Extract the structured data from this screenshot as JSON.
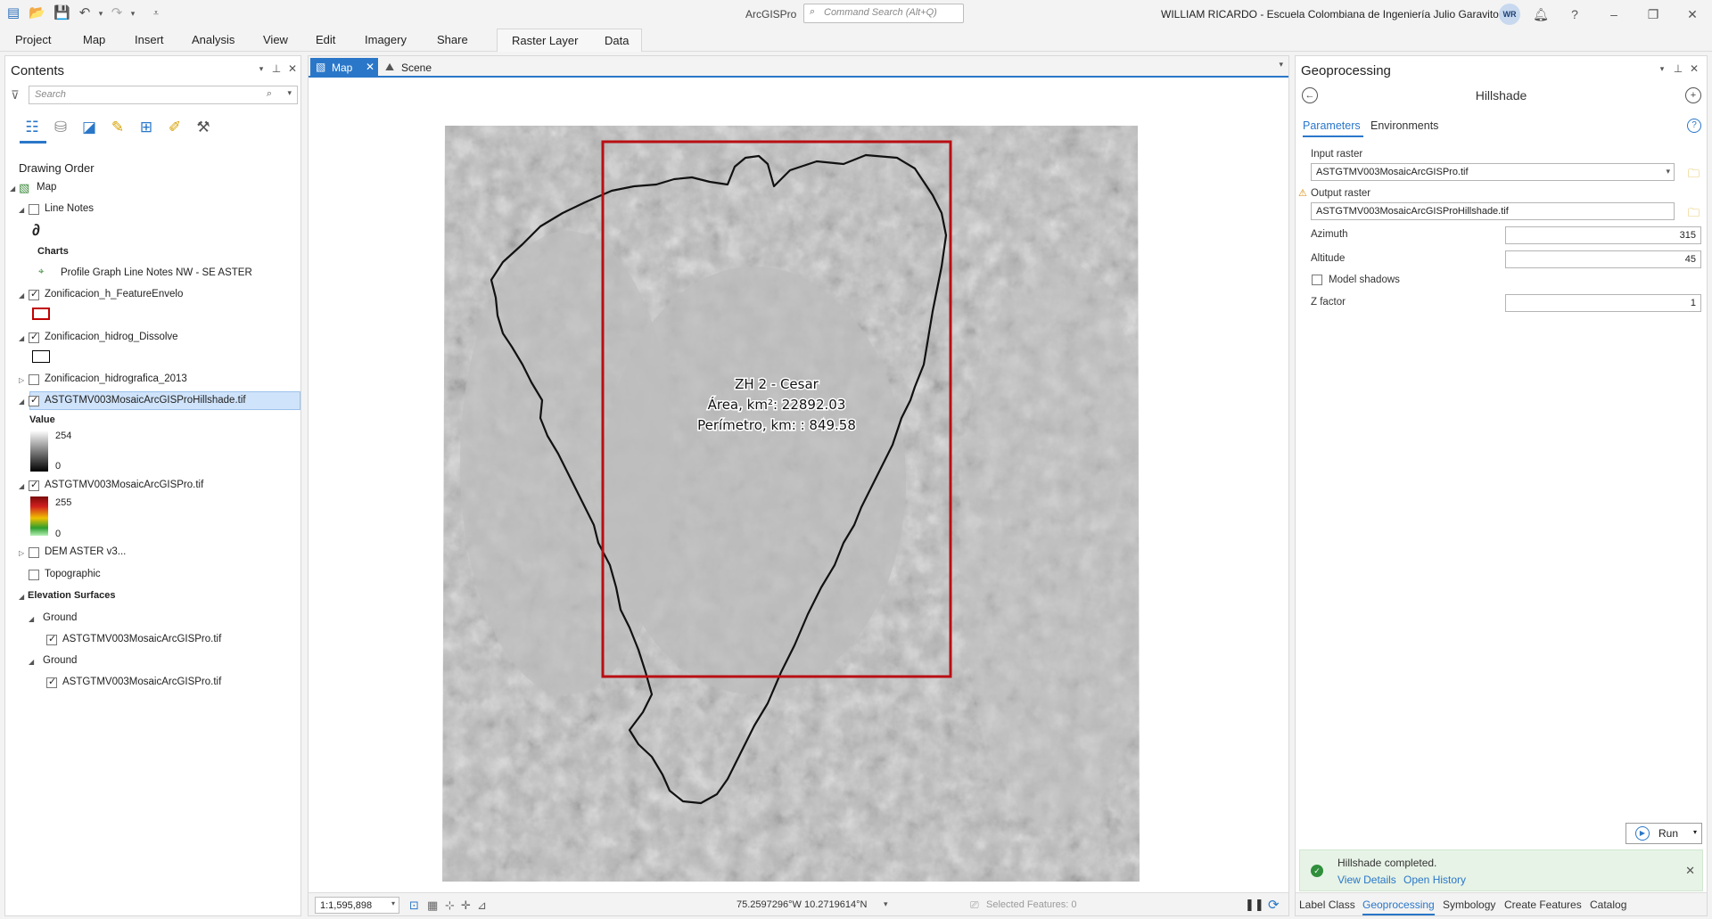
{
  "titlebar": {
    "app_name": "ArcGISPro",
    "search_placeholder": "Command Search (Alt+Q)",
    "user": "WILLIAM RICARDO  - Escuela Colombiana de Ingeniería Julio Garavito",
    "avatar_initials": "WR"
  },
  "ribbon": {
    "tabs": [
      "Project",
      "Map",
      "Insert",
      "Analysis",
      "View",
      "Edit",
      "Imagery",
      "Share"
    ],
    "contextual_tabs": [
      "Raster Layer",
      "Data"
    ]
  },
  "contents": {
    "title": "Contents",
    "search_placeholder": "Search",
    "section_title": "Drawing Order",
    "map_name": "Map",
    "items": {
      "line_notes": "Line Notes",
      "charts": "Charts",
      "profile_graph": "Profile Graph Line Notes NW - SE ASTER",
      "feature_envelope": "Zonificacion_h_FeatureEnvelo",
      "dissolve": "Zonificacion_hidrog_Dissolve",
      "zonificacion_2013": "Zonificacion_hidrografica_2013",
      "hillshade_layer": "ASTGTMV003MosaicArcGISProHillshade.tif",
      "hillshade_value_label": "Value",
      "hillshade_max": "254",
      "hillshade_min": "0",
      "dem_layer": "ASTGTMV003MosaicArcGISPro.tif",
      "dem_max": "255",
      "dem_min": "0",
      "dem_aster": "DEM ASTER v3...",
      "topographic": "Topographic",
      "elevation_surfaces": "Elevation Surfaces",
      "ground_1": "Ground",
      "ground_1_source": "ASTGTMV003MosaicArcGISPro.tif",
      "ground_2": "Ground",
      "ground_2_source": "ASTGTMV003MosaicArcGISPro.tif"
    },
    "checked": {
      "line_notes": false,
      "feature_envelope": true,
      "dissolve": true,
      "zonificacion_2013": false,
      "hillshade_layer": true,
      "dem_layer": true,
      "dem_aster": false,
      "topographic": false,
      "ground_1_source": true,
      "ground_2_source": true
    },
    "colors": {
      "envelope_outline": "#c00000",
      "dissolve_outline": "#000000",
      "selection": "#cfe3fa"
    }
  },
  "map_view": {
    "tabs": [
      "Map",
      "Scene"
    ],
    "label_line1": "ZH 2 - Cesar",
    "label_line2": "Área, km²: 22892.03",
    "label_line3": "Perímetro, km: : 849.58",
    "scale": "1:1,595,898",
    "coordinates": "75.2597296°W 10.2719614°N",
    "selected_features": "Selected Features: 0"
  },
  "geoprocessing": {
    "title": "Geoprocessing",
    "tool_name": "Hillshade",
    "tabs": [
      "Parameters",
      "Environments"
    ],
    "input_raster_label": "Input raster",
    "input_raster_value": "ASTGTMV003MosaicArcGISPro.tif",
    "output_raster_label": "Output raster",
    "output_raster_value": "ASTGTMV003MosaicArcGISProHillshade.tif",
    "azimuth_label": "Azimuth",
    "azimuth_value": "315",
    "altitude_label": "Altitude",
    "altitude_value": "45",
    "model_shadows_label": "Model shadows",
    "model_shadows_checked": false,
    "zfactor_label": "Z factor",
    "zfactor_value": "1",
    "run_label": "Run",
    "message": "Hillshade completed.",
    "view_details": "View Details",
    "open_history": "Open History",
    "bottom_tabs": [
      "Label Class",
      "Geoprocessing",
      "Symbology",
      "Create Features",
      "Catalog"
    ],
    "active_bottom_tab": "Geoprocessing"
  }
}
